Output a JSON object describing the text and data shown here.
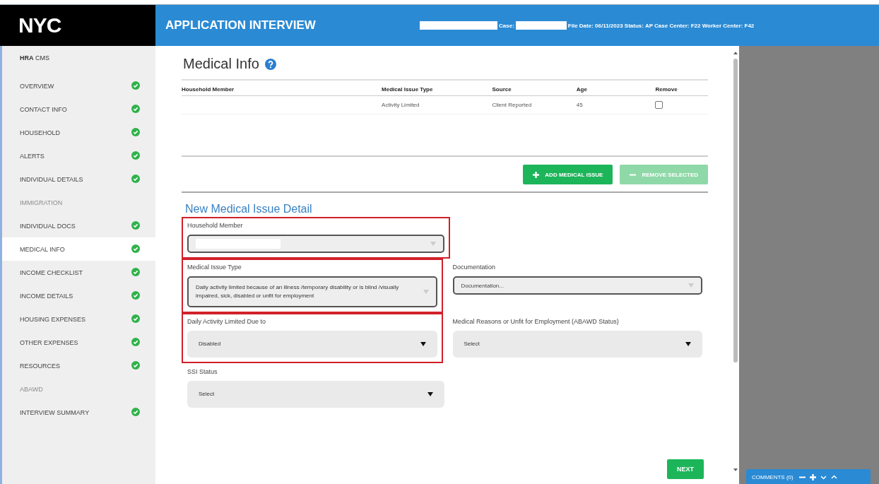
{
  "header": {
    "logo": "NYC",
    "title": "APPLICATION INTERVIEW",
    "case_label": "Case: ",
    "case_info": "File Date: 06/11/2023 Status: AP Case Center: F22 Worker Center: F42"
  },
  "sidebar": {
    "title_bold": "HRA",
    "title_rest": "CMS",
    "items": [
      {
        "label": "OVERVIEW",
        "complete": true,
        "disabled": false,
        "selected": false
      },
      {
        "label": "CONTACT INFO",
        "complete": true,
        "disabled": false,
        "selected": false
      },
      {
        "label": "HOUSEHOLD",
        "complete": true,
        "disabled": false,
        "selected": false
      },
      {
        "label": "ALERTS",
        "complete": true,
        "disabled": false,
        "selected": false
      },
      {
        "label": "INDIVIDUAL DETAILS",
        "complete": true,
        "disabled": false,
        "selected": false
      },
      {
        "label": "IMMIGRATION",
        "complete": false,
        "disabled": true,
        "selected": false
      },
      {
        "label": "INDIVIDUAL DOCS",
        "complete": true,
        "disabled": false,
        "selected": false
      },
      {
        "label": "MEDICAL INFO",
        "complete": true,
        "disabled": false,
        "selected": true
      },
      {
        "label": "INCOME CHECKLIST",
        "complete": true,
        "disabled": false,
        "selected": false
      },
      {
        "label": "INCOME DETAILS",
        "complete": true,
        "disabled": false,
        "selected": false
      },
      {
        "label": "HOUSING EXPENSES",
        "complete": true,
        "disabled": false,
        "selected": false
      },
      {
        "label": "OTHER EXPENSES",
        "complete": true,
        "disabled": false,
        "selected": false
      },
      {
        "label": "RESOURCES",
        "complete": true,
        "disabled": false,
        "selected": false
      },
      {
        "label": "ABAWD",
        "complete": false,
        "disabled": true,
        "selected": false
      },
      {
        "label": "INTERVIEW SUMMARY",
        "complete": true,
        "disabled": false,
        "selected": false
      }
    ]
  },
  "page_title": "Medical Info",
  "table": {
    "columns": [
      "Household Member",
      "Medical Issue Type",
      "Source",
      "Age",
      "Remove"
    ],
    "rows": [
      {
        "medical_issue_type": "Activity Limited",
        "source": "Client Reported",
        "age": "45",
        "remove": false
      }
    ]
  },
  "actions": [
    {
      "label": "ADD MEDICAL ISSUE",
      "kind": "add",
      "disabled": false
    },
    {
      "label": "REMOVE SELECTED",
      "kind": "remove",
      "disabled": true
    }
  ],
  "detail_title": "New Medical Issue Detail",
  "form_rows": [
    [
      {
        "label": "Household Member",
        "kind": "combo",
        "redacted": true,
        "highlighted": true
      }
    ],
    [
      {
        "label": "Medical Issue Type",
        "kind": "combo",
        "value": "Daily activity limited because of an illness /temporary disability or is blind /visually impaired, sick, disabled or unfit for employment",
        "highlighted": true
      },
      {
        "label": "Documentation",
        "kind": "combo",
        "placeholder": "Documentation...",
        "highlighted": false
      }
    ],
    [
      {
        "label": "Daily Activity Limited Due to",
        "kind": "select",
        "value": "Disabled",
        "highlighted": true
      },
      {
        "label": "Medical Reasons or Unfit for Employment (ABAWD Status)",
        "kind": "select",
        "value": "Select",
        "highlighted": false
      }
    ],
    [
      {
        "label": "SSI Status",
        "kind": "select",
        "value": "Select",
        "highlighted": false
      }
    ]
  ],
  "next_button": "NEXT",
  "comments": {
    "label": "COMMENTS (0)"
  }
}
